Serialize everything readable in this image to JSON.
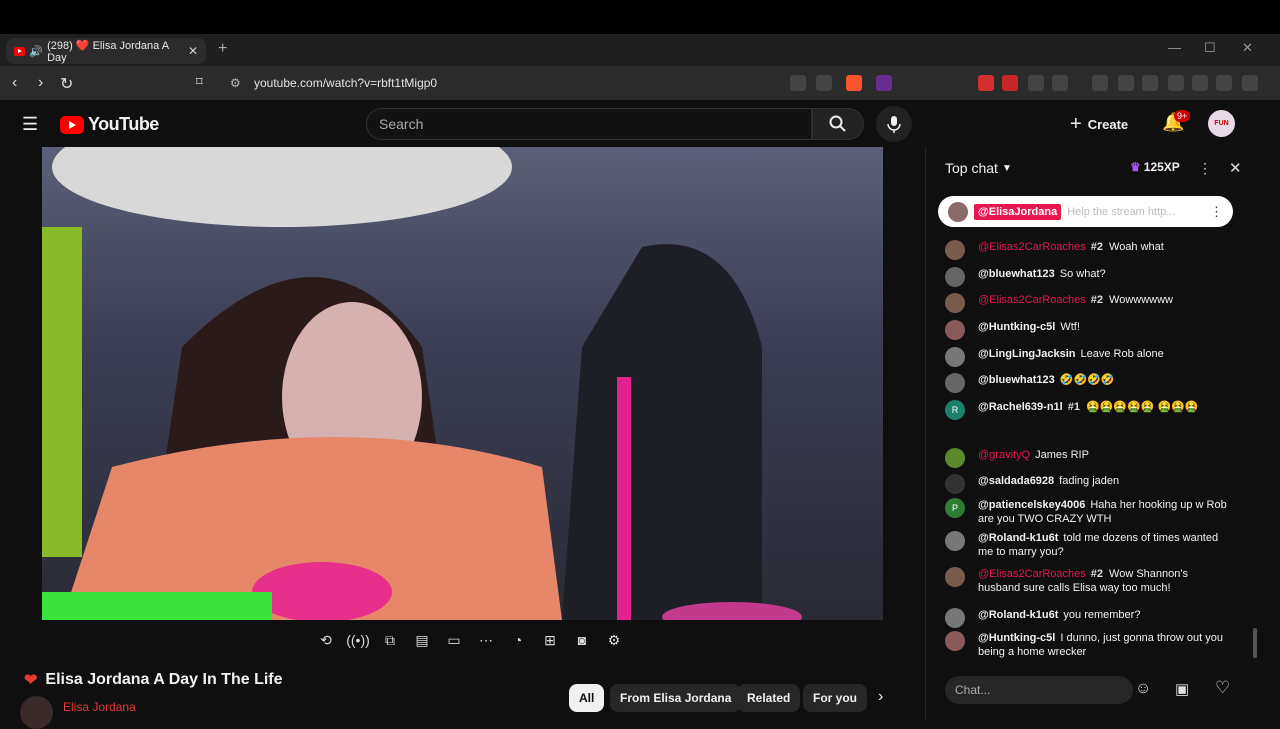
{
  "browser": {
    "tab_title": "(298) ❤️ Elisa Jordana A Day",
    "url": "youtube.com/watch?v=rbft1tMigp0",
    "ext_badges": [
      "7",
      "1"
    ]
  },
  "youtube": {
    "logo_text": "YouTube",
    "search_placeholder": "Search",
    "create_label": "Create",
    "notif_count": "9+",
    "avatar_text": "FUN"
  },
  "video": {
    "title": "Elisa Jordana A Day In The Life",
    "channel": "Elisa Jordana",
    "chips": [
      "All",
      "From Elisa Jordana",
      "Related",
      "For you"
    ]
  },
  "chat": {
    "header": "Top chat",
    "xp": "125XP",
    "pinned": {
      "author": "@ElisaJordana",
      "text": "Help the stream http..."
    },
    "messages": [
      {
        "author": "@Elisas2CarRoaches",
        "mod": true,
        "rank": "#2",
        "text": "Woah what",
        "color": "#7a5a4a"
      },
      {
        "author": "@bluewhat123",
        "mod": false,
        "rank": "",
        "text": "So what?",
        "color": "#666"
      },
      {
        "author": "@Elisas2CarRoaches",
        "mod": true,
        "rank": "#2",
        "text": "Wowwwwww",
        "color": "#7a5a4a"
      },
      {
        "author": "@Huntking-c5l",
        "mod": false,
        "rank": "",
        "text": "Wtf!",
        "color": "#8a5a5a"
      },
      {
        "author": "@LingLingJacksin",
        "mod": false,
        "rank": "",
        "text": "Leave Rob alone",
        "color": "#777"
      },
      {
        "author": "@bluewhat123",
        "mod": false,
        "rank": "",
        "text": "🤣🤣🤣🤣",
        "color": "#666"
      },
      {
        "author": "@Rachel639-n1l",
        "mod": false,
        "rank": "#1",
        "text": "🤮🤮🤮🤮🤮 🤮🤮🤮",
        "color": "#1a7f6b",
        "initial": "R"
      },
      {
        "author": "@gravityQ",
        "mod": true,
        "rank": "",
        "text": "James RIP",
        "color": "#5a8a2a"
      },
      {
        "author": "@saldada6928",
        "mod": false,
        "rank": "",
        "text": "fading jaden",
        "color": "#333"
      },
      {
        "author": "@patiencelskey4006",
        "mod": false,
        "rank": "",
        "text": "Haha her hooking up w Rob are you TWO CRAZY WTH",
        "color": "#2e7d32",
        "initial": "P"
      },
      {
        "author": "@Roland-k1u6t",
        "mod": false,
        "rank": "",
        "text": "told me dozens of times wanted me to marry you?",
        "color": "#777"
      },
      {
        "author": "@Elisas2CarRoaches",
        "mod": true,
        "rank": "#2",
        "text": "Wow Shannon's husband sure calls Elisa way too much!",
        "color": "#7a5a4a"
      },
      {
        "author": "@Roland-k1u6t",
        "mod": false,
        "rank": "",
        "text": "you remember?",
        "color": "#777"
      },
      {
        "author": "@Huntking-c5l",
        "mod": false,
        "rank": "",
        "text": "I dunno, just gonna throw out you being a home wrecker",
        "color": "#8a5a5a"
      }
    ],
    "input_placeholder": "Chat..."
  }
}
